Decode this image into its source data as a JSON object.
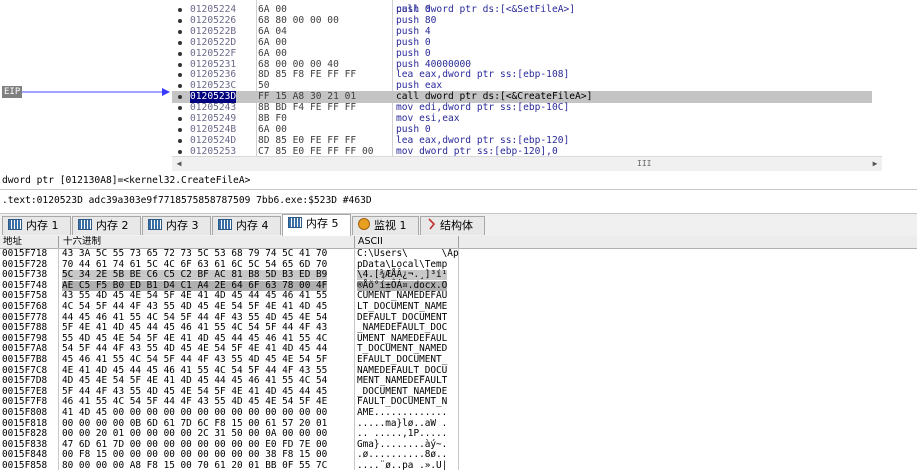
{
  "disasm": {
    "eip_label": "EIP",
    "lines": [
      {
        "addr": "01205224",
        "hex": "6A 00",
        "ins": "push 0",
        "cur": false
      },
      {
        "addr": "01205226",
        "hex": "68 80 00 00 00",
        "ins": "push 80",
        "cur": false
      },
      {
        "addr": "0120522B",
        "hex": "6A 04",
        "ins": "push 4",
        "cur": false
      },
      {
        "addr": "0120522D",
        "hex": "6A 00",
        "ins": "push 0",
        "cur": false
      },
      {
        "addr": "0120522F",
        "hex": "6A 00",
        "ins": "push 0",
        "cur": false
      },
      {
        "addr": "01205231",
        "hex": "68 00 00 00 40",
        "ins": "push 40000000",
        "cur": false
      },
      {
        "addr": "01205236",
        "hex": "8D 85 F8 FE FF FF",
        "ins": "lea eax,dword ptr ss:[ebp-108]",
        "cur": false
      },
      {
        "addr": "0120523C",
        "hex": "50",
        "ins": "push eax",
        "cur": false
      },
      {
        "addr": "0120523D",
        "hex": "FF 15 A8 30 21 01",
        "ins": "call dword ptr ds:[<&CreateFileA>]",
        "cur": true
      },
      {
        "addr": "01205243",
        "hex": "8B BD F4 FE FF FF",
        "ins": "mov edi,dword ptr ss:[ebp-10C]",
        "cur": false
      },
      {
        "addr": "01205249",
        "hex": "8B F0",
        "ins": "mov esi,eax",
        "cur": false
      },
      {
        "addr": "0120524B",
        "hex": "6A 00",
        "ins": "push 0",
        "cur": false
      },
      {
        "addr": "0120524D",
        "hex": "8D 85 E0 FE FF FF",
        "ins": "lea eax,dword ptr ss:[ebp-120]",
        "cur": false
      },
      {
        "addr": "01205253",
        "hex": "C7 85 E0 FE FF FF 00",
        "ins": "mov dword ptr ss:[ebp-120],0",
        "cur": false
      }
    ],
    "top_partial": "call dword ptr ds:[<&SetFileA>]",
    "scroll_grip": "III"
  },
  "info": {
    "line1": "dword ptr [012130A8]=<kernel32.CreateFileA>",
    "line2": ".text:0120523D adc39a303e9f7718575858787509 7bb6.exe:$523D #463D"
  },
  "tabs": [
    {
      "label": "内存 1",
      "icon": "memory-icon",
      "active": false
    },
    {
      "label": "内存 2",
      "icon": "memory-icon",
      "active": false
    },
    {
      "label": "内存 3",
      "icon": "memory-icon",
      "active": false
    },
    {
      "label": "内存 4",
      "icon": "memory-icon",
      "active": false
    },
    {
      "label": "内存 5",
      "icon": "memory-icon",
      "active": true
    },
    {
      "label": "监视 1",
      "icon": "watch-icon",
      "active": false
    },
    {
      "label": "结构体",
      "icon": "struct-icon",
      "active": false
    }
  ],
  "dump": {
    "headers": {
      "address": "地址",
      "hex": "十六进制",
      "ascii": "ASCII"
    },
    "rows": [
      {
        "addr": "0015F718",
        "hex": "43 3A 5C 55 73 65 72 73 5C 53 68 79 74 5C 41 70",
        "ascii": "C:\\Users\\      \\Ap"
      },
      {
        "addr": "0015F728",
        "hex": "70 44 61 74 61 5C 4C 6F 63 61 6C 5C 54 65 6D 70",
        "ascii": "pData\\Local\\Temp"
      },
      {
        "addr": "0015F738",
        "hex": "5C 34 2E 5B BE C6 C5 C2 BF AC 81 B8 5D B3 ED B9",
        "ascii": "\\4.[¾ÆÅÂ¿¬.¸]³í¹"
      },
      {
        "addr": "0015F748",
        "hex": "AE C5 F5 B0 ED B1 D4 C1 A4 2E 64 6F 63 78 00 4F",
        "ascii": "®Åõ°í±ÔÁ¤.docx.O"
      },
      {
        "addr": "0015F758",
        "hex": "43 55 4D 45 4E 54 5F 4E 41 4D 45 44 45 46 41 55",
        "ascii": "CUMENT_NAMEDEFAU"
      },
      {
        "addr": "0015F768",
        "hex": "4C 54 5F 44 4F 43 55 4D 45 4E 54 5F 4E 41 4D 45",
        "ascii": "LT_DOCUMENT_NAME"
      },
      {
        "addr": "0015F778",
        "hex": "44 45 46 41 55 4C 54 5F 44 4F 43 55 4D 45 4E 54",
        "ascii": "DEFAULT_DOCUMENT"
      },
      {
        "addr": "0015F788",
        "hex": "5F 4E 41 4D 45 44 45 46 41 55 4C 54 5F 44 4F 43",
        "ascii": "_NAMEDEFAULT_DOC"
      },
      {
        "addr": "0015F798",
        "hex": "55 4D 45 4E 54 5F 4E 41 4D 45 44 45 46 41 55 4C",
        "ascii": "UMENT_NAMEDEFAUL"
      },
      {
        "addr": "0015F7A8",
        "hex": "54 5F 44 4F 43 55 4D 45 4E 54 5F 4E 41 4D 45 44",
        "ascii": "T_DOCUMENT_NAMED"
      },
      {
        "addr": "0015F7B8",
        "hex": "45 46 41 55 4C 54 5F 44 4F 43 55 4D 45 4E 54 5F",
        "ascii": "EFAULT_DOCUMENT_"
      },
      {
        "addr": "0015F7C8",
        "hex": "4E 41 4D 45 44 45 46 41 55 4C 54 5F 44 4F 43 55",
        "ascii": "NAMEDEFAULT_DOCU"
      },
      {
        "addr": "0015F7D8",
        "hex": "4D 45 4E 54 5F 4E 41 4D 45 44 45 46 41 55 4C 54",
        "ascii": "MENT_NAMEDEFAULT"
      },
      {
        "addr": "0015F7E8",
        "hex": "5F 44 4F 43 55 4D 45 4E 54 5F 4E 41 4D 45 44 45",
        "ascii": "_DOCUMENT_NAMEDE"
      },
      {
        "addr": "0015F7F8",
        "hex": "46 41 55 4C 54 5F 44 4F 43 55 4D 45 4E 54 5F 4E",
        "ascii": "FAULT_DOCUMENT_N"
      },
      {
        "addr": "0015F808",
        "hex": "41 4D 45 00 00 00 00 00 00 00 00 00 00 00 00 00",
        "ascii": "AME............."
      },
      {
        "addr": "0015F818",
        "hex": "00 00 00 00 0B 6D 61 7D 6C F8 15 00 61 57 20 01",
        "ascii": ".....ma}lø..aW ."
      },
      {
        "addr": "0015F828",
        "hex": "00 00 20 01 00 00 00 00 2C 31 50 00 0A 00 00 00",
        "ascii": ".. .....,1P....."
      },
      {
        "addr": "0015F838",
        "hex": "47 6D 61 7D 00 00 00 00 00 00 00 00 E0 FD 7E 00",
        "ascii": "Gma}........àý~."
      },
      {
        "addr": "0015F848",
        "hex": "00 F8 15 00 00 00 00 00 00 00 00 00 38 F8 15 00",
        "ascii": ".ø..........8ø.."
      },
      {
        "addr": "0015F858",
        "hex": "80 00 00 00 A8 F8 15 00 70 61 20 01 BB 0F 55 7C",
        "ascii": "....¨ø..pa .».U|"
      }
    ]
  },
  "colors": {
    "eip": "#808080",
    "cur_line": "#c4c4c4",
    "cur_addr": "#000080",
    "hilite": "#00a0ff",
    "selection": "#c8c8c8"
  }
}
